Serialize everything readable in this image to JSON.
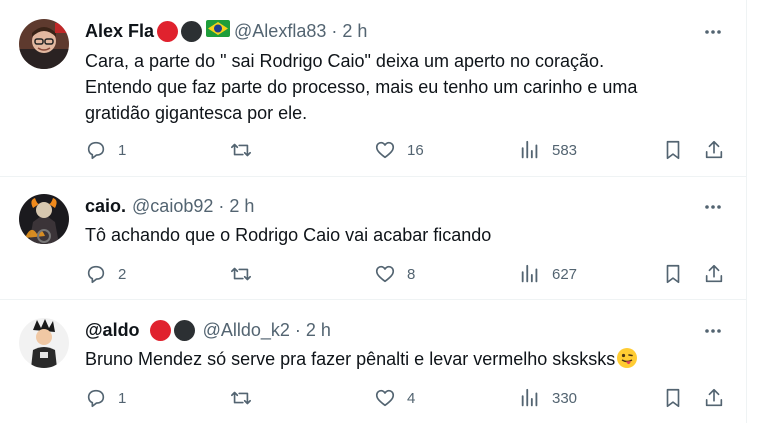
{
  "tweets": [
    {
      "name": "Alex Fla",
      "badges": [
        "red",
        "dark"
      ],
      "flag": "brazil-flag",
      "handle": "@Alexfla83",
      "separator": "·",
      "time": "2 h",
      "lines": [
        "Cara, a parte do \" sai Rodrigo Caio\" deixa um aperto no coração.",
        "Entendo que faz parte do processo, mais eu tenho um carinho e uma",
        "gratidão gigantesca por ele."
      ],
      "replies": "1",
      "retweets": "",
      "likes": "16",
      "views": "583"
    },
    {
      "name": "caio.",
      "badges": [],
      "handle": "@caiob92",
      "separator": "·",
      "time": "2 h",
      "lines": [
        "Tô achando que o Rodrigo Caio vai acabar ficando"
      ],
      "replies": "2",
      "retweets": "",
      "likes": "8",
      "views": "627"
    },
    {
      "name": "@aldo",
      "badges": [
        "red",
        "dark"
      ],
      "handle": "@Alldo_k2",
      "separator": "·",
      "time": "2 h",
      "lines": [
        "Bruno Mendez só serve pra fazer pênalti e levar vermelho sksksks"
      ],
      "emoji": "face-with-tongue-emoji",
      "replies": "1",
      "retweets": "",
      "likes": "4",
      "views": "330"
    }
  ],
  "colors": {
    "text": "#0f1419",
    "muted": "#536471",
    "border": "#eff3f4",
    "red_badge": "#e0222e",
    "dark_badge": "#2c3033"
  }
}
